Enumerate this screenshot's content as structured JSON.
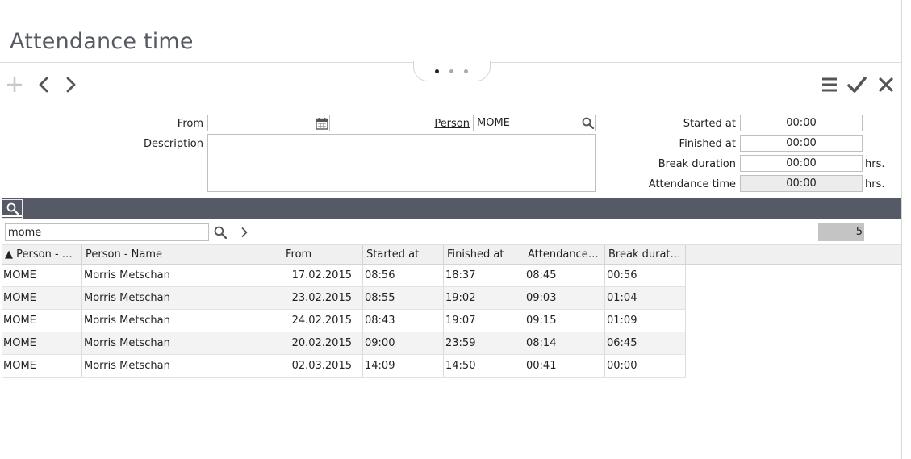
{
  "page": {
    "title": "Attendance time"
  },
  "toolbar": {
    "add_icon": "plus-icon",
    "prev_icon": "chevron-left-icon",
    "next_icon": "chevron-right-icon",
    "menu_icon": "hamburger-menu-icon",
    "confirm_icon": "checkmark-icon",
    "close_icon": "close-icon"
  },
  "form": {
    "from_label": "From",
    "from_value": "",
    "description_label": "Description",
    "description_value": "",
    "person_label": "Person",
    "person_value": "MOME",
    "started_label": "Started at",
    "started_value": "00:00",
    "finished_label": "Finished at",
    "finished_value": "00:00",
    "break_label": "Break duration",
    "break_value": "00:00",
    "break_unit": "hrs.",
    "attendance_label": "Attendance time",
    "attendance_value": "00:00",
    "attendance_unit": "hrs."
  },
  "grid": {
    "filter_value": "mome",
    "count": "5",
    "columns": [
      {
        "label": "▲ Person - S..."
      },
      {
        "label": "Person - Name"
      },
      {
        "label": "From"
      },
      {
        "label": "Started at"
      },
      {
        "label": "Finished at"
      },
      {
        "label": "Attendance t..."
      },
      {
        "label": "Break durati..."
      }
    ],
    "rows": [
      {
        "person": "MOME",
        "name": "Morris Metschan",
        "from": "17.02.2015",
        "started": "08:56",
        "finished": "18:37",
        "attendance": "08:45",
        "break": "00:56"
      },
      {
        "person": "MOME",
        "name": "Morris Metschan",
        "from": "23.02.2015",
        "started": "08:55",
        "finished": "19:02",
        "attendance": "09:03",
        "break": "01:04"
      },
      {
        "person": "MOME",
        "name": "Morris Metschan",
        "from": "24.02.2015",
        "started": "08:43",
        "finished": "19:07",
        "attendance": "09:15",
        "break": "01:09"
      },
      {
        "person": "MOME",
        "name": "Morris Metschan",
        "from": "20.02.2015",
        "started": "09:00",
        "finished": "23:59",
        "attendance": "08:14",
        "break": "06:45"
      },
      {
        "person": "MOME",
        "name": "Morris Metschan",
        "from": "02.03.2015",
        "started": "14:09",
        "finished": "14:50",
        "attendance": "00:41",
        "break": "00:00"
      }
    ]
  },
  "colors": {
    "header_bar": "#555a66",
    "title_text": "#555a63",
    "readonly_bg": "#ececec",
    "alt_row_bg": "#f3f3f3"
  }
}
